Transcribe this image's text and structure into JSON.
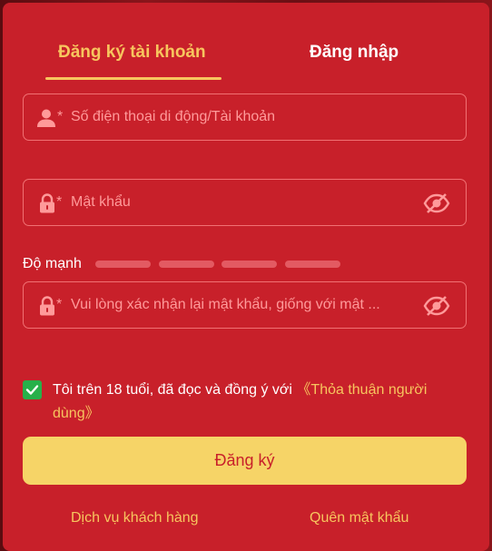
{
  "tabs": {
    "register_label": "Đăng ký tài khoản",
    "login_label": "Đăng nhập"
  },
  "fields": {
    "account": {
      "star": "*",
      "placeholder": "Số điện thoại di động/Tài khoản",
      "value": ""
    },
    "password": {
      "star": "*",
      "placeholder": "Mật khẩu",
      "value": ""
    },
    "confirm": {
      "star": "*",
      "placeholder": "Vui lòng xác nhận lại mật khẩu, giống với mật ...",
      "value": ""
    }
  },
  "strength": {
    "label": "Độ mạnh",
    "segments_filled": 0,
    "segments_total": 4
  },
  "agreement": {
    "checked": true,
    "text": "Tôi trên 18 tuổi, đã đọc và đồng ý với ",
    "link": "《Thỏa thuận người dùng》"
  },
  "submit_label": "Đăng ký",
  "footer": {
    "support_label": "Dịch vụ khách hàng",
    "forgot_label": "Quên mật khẩu"
  },
  "icons": {
    "user": "user-icon",
    "lock": "lock-icon",
    "eye": "eye-off-icon",
    "check": "check-icon"
  },
  "colors": {
    "panel": "#c8202a",
    "accent": "#f7c55e",
    "button": "#f6d467",
    "checkbox": "#27b04a"
  }
}
